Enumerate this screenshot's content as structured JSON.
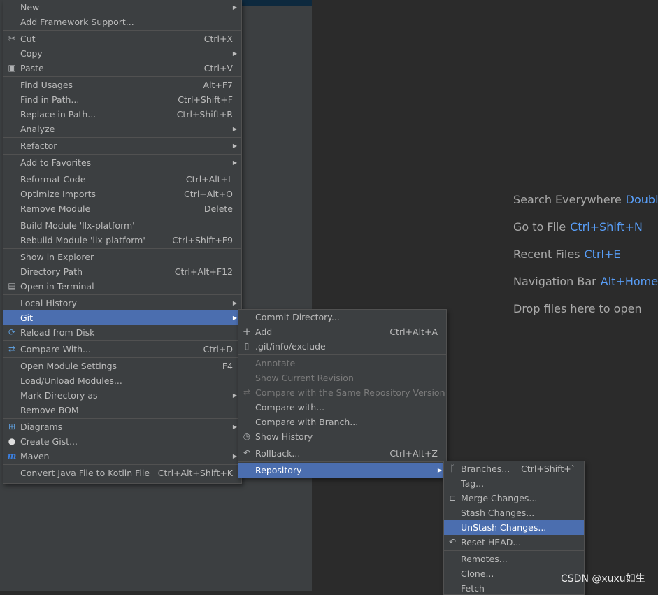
{
  "main_menu": {
    "new": "New",
    "add_framework": "Add Framework Support...",
    "cut": "Cut",
    "cut_sc": "Ctrl+X",
    "copy": "Copy",
    "paste": "Paste",
    "paste_sc": "Ctrl+V",
    "find_usages": "Find Usages",
    "find_usages_sc": "Alt+F7",
    "find_in_path": "Find in Path...",
    "find_in_path_sc": "Ctrl+Shift+F",
    "replace_in_path": "Replace in Path...",
    "replace_in_path_sc": "Ctrl+Shift+R",
    "analyze": "Analyze",
    "refactor": "Refactor",
    "add_to_favorites": "Add to Favorites",
    "reformat": "Reformat Code",
    "reformat_sc": "Ctrl+Alt+L",
    "optimize": "Optimize Imports",
    "optimize_sc": "Ctrl+Alt+O",
    "remove_module": "Remove Module",
    "remove_module_sc": "Delete",
    "build_module": "Build Module 'llx-platform'",
    "rebuild_module": "Rebuild Module 'llx-platform'",
    "rebuild_module_sc": "Ctrl+Shift+F9",
    "show_explorer": "Show in Explorer",
    "directory_path": "Directory Path",
    "directory_path_sc": "Ctrl+Alt+F12",
    "open_terminal": "Open in Terminal",
    "local_history": "Local History",
    "git": "Git",
    "reload": "Reload from Disk",
    "compare_with": "Compare With...",
    "compare_with_sc": "Ctrl+D",
    "open_module_settings": "Open Module Settings",
    "open_module_settings_sc": "F4",
    "load_unload": "Load/Unload Modules...",
    "mark_directory": "Mark Directory as",
    "remove_bom": "Remove BOM",
    "diagrams": "Diagrams",
    "create_gist": "Create Gist...",
    "maven": "Maven",
    "convert_kotlin": "Convert Java File to Kotlin File",
    "convert_kotlin_sc": "Ctrl+Alt+Shift+K"
  },
  "git_menu": {
    "commit_dir": "Commit Directory...",
    "add": "Add",
    "add_sc": "Ctrl+Alt+A",
    "git_exclude": ".git/info/exclude",
    "annotate": "Annotate",
    "show_current_revision": "Show Current Revision",
    "compare_same_repo": "Compare with the Same Repository Version",
    "compare_with": "Compare with...",
    "compare_branch": "Compare with Branch...",
    "show_history": "Show History",
    "rollback": "Rollback...",
    "rollback_sc": "Ctrl+Alt+Z",
    "repository": "Repository"
  },
  "repo_menu": {
    "branches": "Branches...",
    "branches_sc": "Ctrl+Shift+`",
    "tag": "Tag...",
    "merge_changes": "Merge Changes...",
    "stash_changes": "Stash Changes...",
    "unstash_changes": "UnStash Changes...",
    "reset_head": "Reset HEAD...",
    "remotes": "Remotes...",
    "clone": "Clone...",
    "fetch": "Fetch"
  },
  "welcome": {
    "search_label": "Search Everywhere",
    "search_key": "Double",
    "goto_label": "Go to File",
    "goto_key": "Ctrl+Shift+N",
    "recent_label": "Recent Files",
    "recent_key": "Ctrl+E",
    "nav_label": "Navigation Bar",
    "nav_key": "Alt+Home",
    "drop_label": "Drop files here to open"
  },
  "watermark": "CSDN @xuxu如生",
  "colors": {
    "selection": "#4b6eaf",
    "shortcut_blue": "#589df6",
    "menu_bg": "#3c3f41",
    "editor_bg": "#2b2b2b"
  },
  "icons": {
    "cut": "scissors-icon",
    "paste": "clipboard-icon",
    "terminal": "terminal-icon",
    "reload": "reload-icon",
    "compare": "compare-arrows-icon",
    "diagrams": "diagram-icon",
    "gist": "github-icon",
    "maven": "maven-icon",
    "add": "plus-icon",
    "exclude": "git-file-icon",
    "history": "clock-icon",
    "rollback": "undo-icon",
    "branches": "branch-icon",
    "merge": "merge-icon",
    "reset": "undo-icon"
  }
}
